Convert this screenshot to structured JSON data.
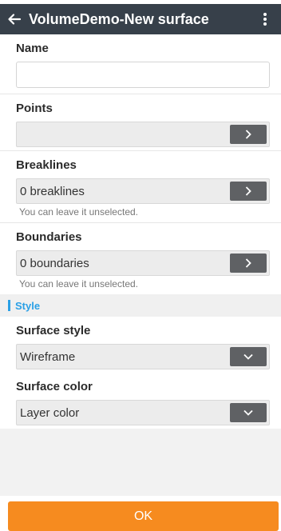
{
  "app_bar": {
    "title": "VolumeDemo-New surface",
    "back_icon": "arrow-left-icon",
    "menu_icon": "more-vert-icon"
  },
  "form": {
    "name": {
      "label": "Name",
      "value": "",
      "placeholder": ""
    },
    "points": {
      "label": "Points",
      "value": "",
      "button_icon": "chevron-right-icon"
    },
    "breaklines": {
      "label": "Breaklines",
      "value": "0 breaklines",
      "hint": "You can leave it unselected.",
      "button_icon": "chevron-right-icon"
    },
    "boundaries": {
      "label": "Boundaries",
      "value": "0 boundaries",
      "hint": "You can leave it unselected.",
      "button_icon": "chevron-right-icon"
    },
    "style_section": {
      "title": "Style",
      "accent": "#2aa0e6"
    },
    "surface_style": {
      "label": "Surface style",
      "value": "Wireframe",
      "button_icon": "chevron-down-icon"
    },
    "surface_color": {
      "label": "Surface color",
      "value": "Layer color",
      "button_icon": "chevron-down-icon"
    }
  },
  "ok_button": {
    "label": "OK",
    "color": "#f68b1f"
  }
}
